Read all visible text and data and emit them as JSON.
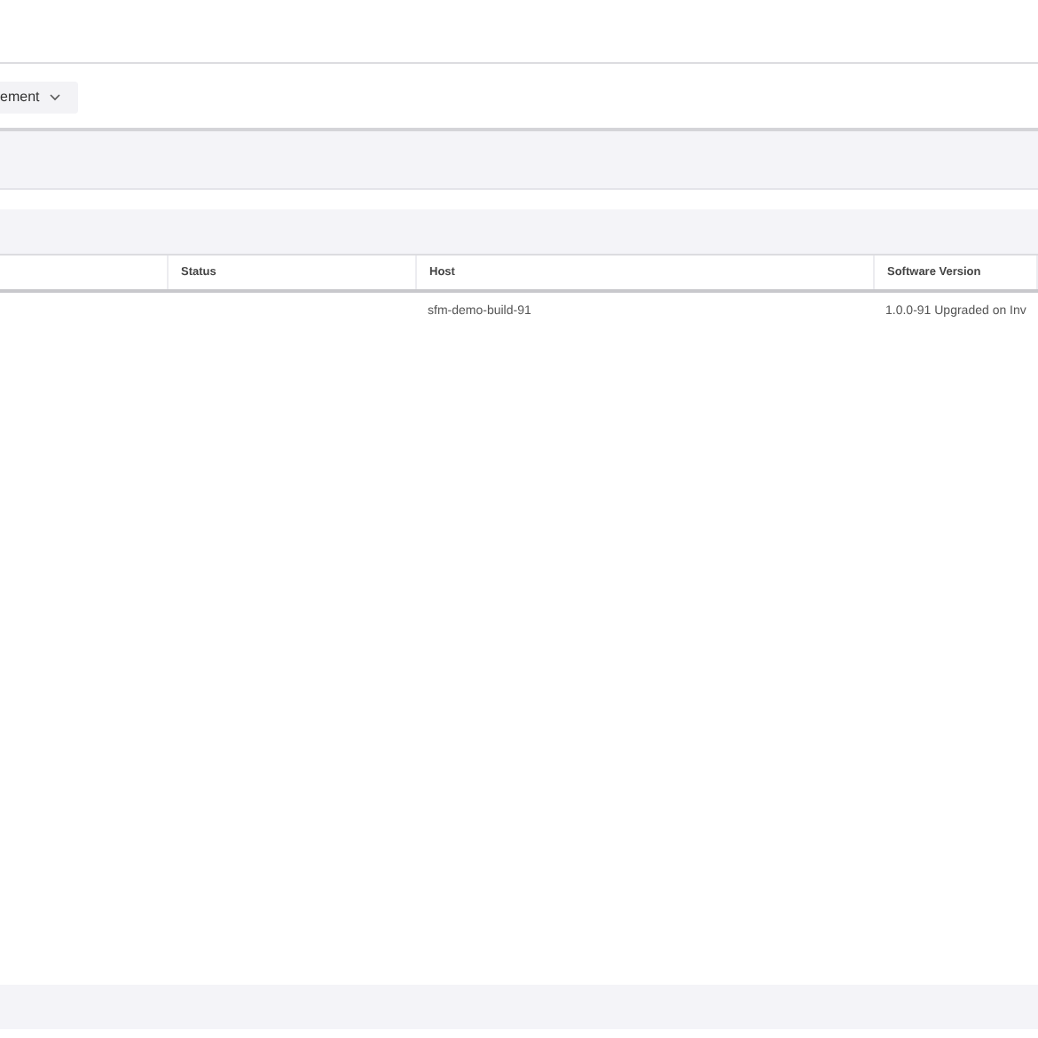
{
  "toolbar": {
    "dropdown": {
      "label": "ement"
    }
  },
  "table": {
    "columns": [
      "",
      "Status",
      "Host",
      "Software Version"
    ],
    "rows": [
      [
        "",
        "",
        "sfm-demo-build-91",
        "1.0.0-91 Upgraded on Inv"
      ]
    ]
  }
}
